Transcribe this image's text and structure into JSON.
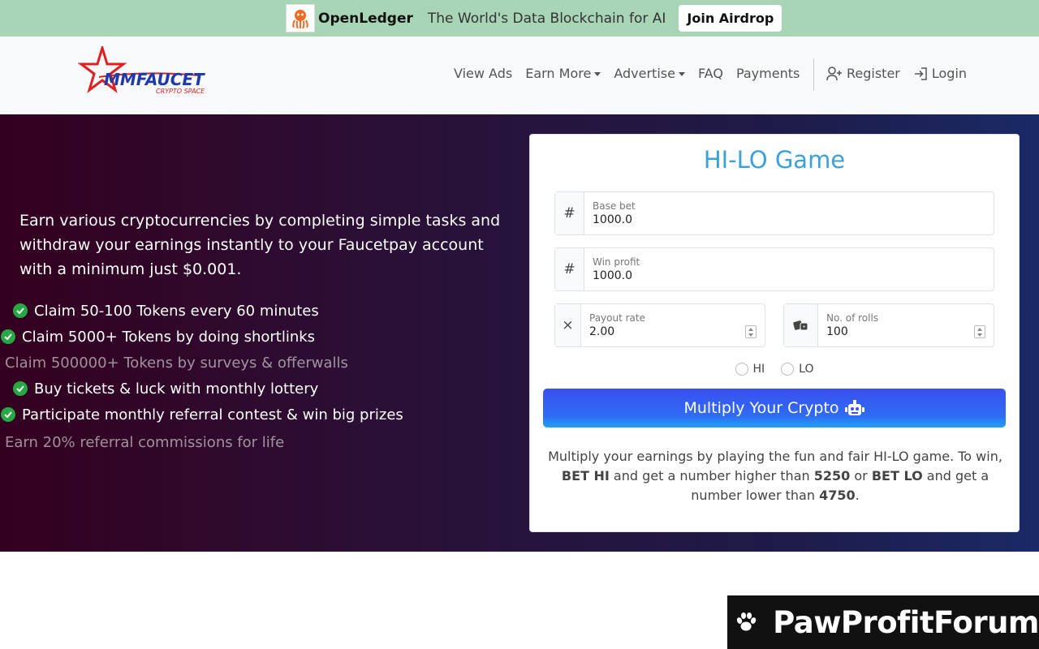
{
  "banner": {
    "brand": "OpenLedger",
    "tagline": "The World's Data Blockchain for AI",
    "cta": "Join Airdrop"
  },
  "navbar": {
    "logo_text": "MMFAUCET",
    "logo_subtext": "CRYPTO SPACE",
    "items": [
      {
        "label": "View Ads",
        "dropdown": false
      },
      {
        "label": "Earn More",
        "dropdown": true
      },
      {
        "label": "Advertise",
        "dropdown": true
      },
      {
        "label": "FAQ",
        "dropdown": false
      },
      {
        "label": "Payments",
        "dropdown": false
      }
    ],
    "register": "Register",
    "login": "Login"
  },
  "hero": {
    "intro": "Earn various cryptocurrencies by completing simple tasks and withdraw your earnings instantly to your Faucetpay account with a minimum just $0.001.",
    "features": [
      "Claim 50-100 Tokens every 60 minutes",
      "Claim 5000+ Tokens by doing shortlinks",
      "Claim 500000+ Tokens by surveys & offerwalls",
      "Buy tickets & luck with monthly lottery",
      "Participate monthly referral contest & win big prizes",
      "Earn 20% referral commissions for life"
    ]
  },
  "game": {
    "title": "HI-LO Game",
    "base_bet": {
      "label": "Base bet",
      "value": "1000.0",
      "icon": "#"
    },
    "win_profit": {
      "label": "Win profit",
      "value": "1000.0",
      "icon": "#"
    },
    "payout_rate": {
      "label": "Payout rate",
      "value": "2.00",
      "icon": "×"
    },
    "rolls": {
      "label": "No. of rolls",
      "value": "100"
    },
    "hi_label": "HI",
    "lo_label": "LO",
    "button": "Multiply Your Crypto",
    "desc_1": "Multiply your earnings by playing the fun and fair HI-LO game. To win,",
    "bet_hi": "BET HI",
    "desc_2": "and get a number higher than",
    "hi_num": "5250",
    "desc_3": "or",
    "bet_lo": "BET LO",
    "desc_4": "and get a number lower than",
    "lo_num": "4750",
    "desc_5": "."
  },
  "watermark": {
    "text": "PawProfitForum"
  },
  "colors": {
    "title": "#3ba1d8",
    "check": "#28a745",
    "banner": "#a8d5b5"
  }
}
